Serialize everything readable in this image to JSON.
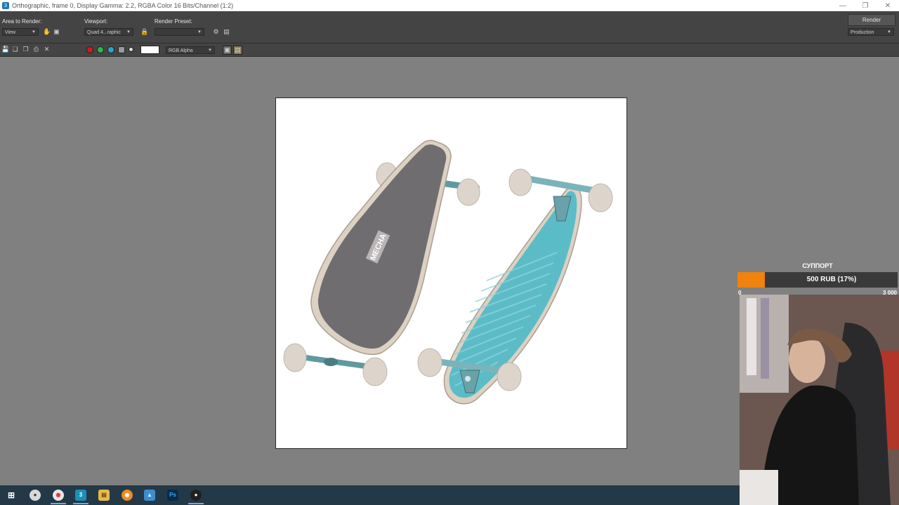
{
  "window": {
    "title": "Orthographic, frame 0, Display Gamma: 2.2, RGBA Color 16 Bits/Channel (1:2)",
    "controls": [
      "minimize-icon",
      "restore-icon",
      "close-icon"
    ]
  },
  "options": {
    "area_label": "Area to Render:",
    "area_value": "View",
    "viewport_label": "Viewport:",
    "viewport_value": "Quad 4...raphic",
    "preset_label": "Render Preset:",
    "preset_value": "",
    "render_button": "Render",
    "production_value": "Production"
  },
  "toolbar": {
    "icons": [
      "save-image-icon",
      "copy-image-icon",
      "clone-window-icon",
      "print-icon",
      "clear-icon"
    ],
    "channels": [
      {
        "name": "red-channel",
        "color": "#d01c1c"
      },
      {
        "name": "green-channel",
        "color": "#2db84a"
      },
      {
        "name": "blue-channel",
        "color": "#2aa6c8"
      },
      {
        "name": "alpha-channel",
        "color": "#9a9a9a"
      }
    ],
    "channel_display": "RGB Alpha"
  },
  "render": {
    "deck_text": "MECHA",
    "colors": {
      "grip": "#6f6d70",
      "teal": "#5bbcc7",
      "wheel": "#ddd5cc"
    }
  },
  "support": {
    "title": "СУППОРТ",
    "amount_text": "500 RUB (17%)",
    "progress_percent": 17,
    "min": "0",
    "max": "3 000"
  },
  "taskbar": {
    "apps": [
      "windows-start-icon",
      "app-icon",
      "chrome-icon",
      "3dsmax-icon",
      "file-explorer-icon",
      "blender-icon",
      "photos-icon",
      "photoshop-icon",
      "obs-icon"
    ]
  }
}
